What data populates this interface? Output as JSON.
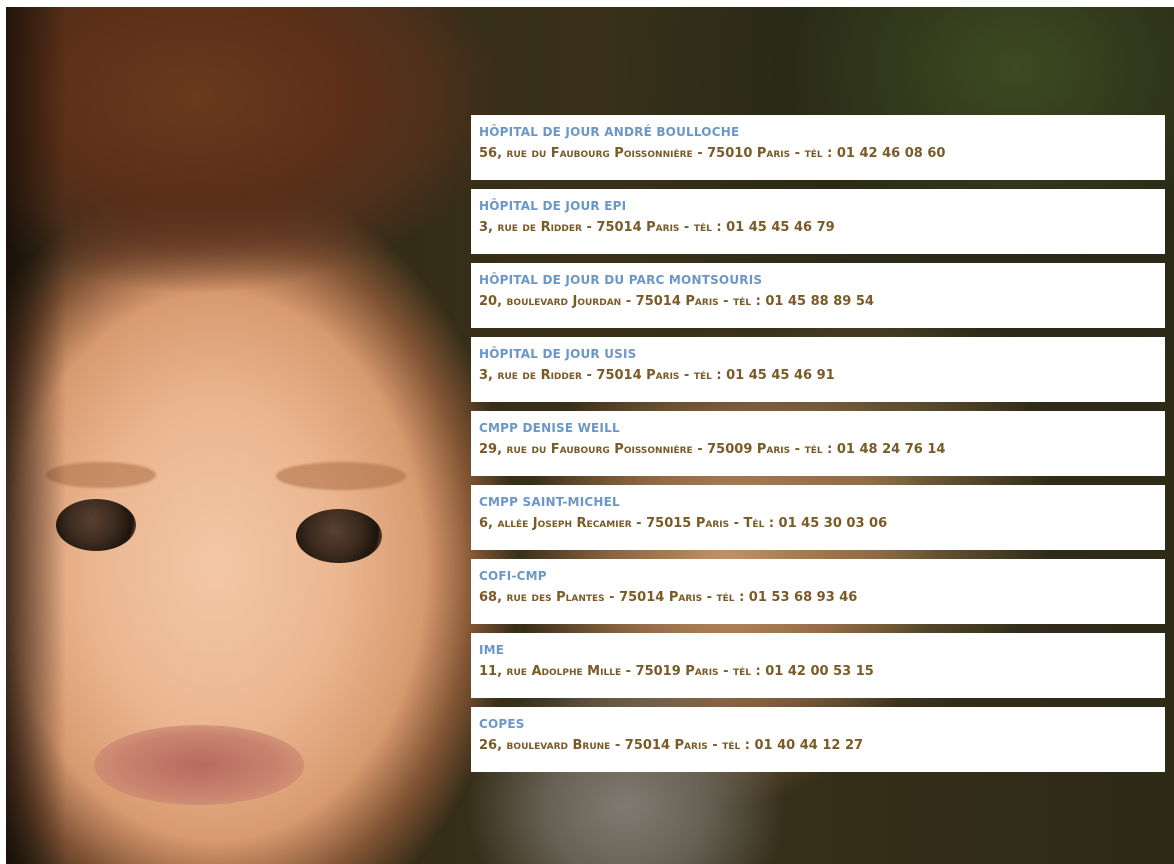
{
  "photo": {
    "description_icon": "child-portrait-photo"
  },
  "colors": {
    "title": "#6b97c8",
    "address": "#7a5a26",
    "card_background": "#ffffff"
  },
  "entries": [
    {
      "name": "Hôpital de jour André Boulloche",
      "address": "56, rue du Faubourg Poissonnière - 75010 Paris - tél : 01 42 46 08 60"
    },
    {
      "name": "Hôpital de jour EPI",
      "address": "3, rue de Ridder - 75014 Paris - tél : 01 45 45 46 79"
    },
    {
      "name": "Hôpital de jour du Parc Montsouris",
      "address": "20, boulevard Jourdan - 75014 Paris - tél : 01 45 88 89 54"
    },
    {
      "name": "Hôpital de jour USIS",
      "address": "3, rue de Ridder - 75014 Paris - tél : 01 45 45 46 91"
    },
    {
      "name": "CMPP Denise Weill",
      "address": "29, rue du Faubourg Poissonnière - 75009 Paris - tél : 01 48 24 76 14"
    },
    {
      "name": "CMPP Saint-Michel",
      "address": "6, allée Joseph Recamier - 75015 Paris - Tél : 01 45 30 03 06"
    },
    {
      "name": "COFI-CMP",
      "address": "68, rue des Plantes - 75014 Paris - tél : 01 53 68 93 46"
    },
    {
      "name": "IME",
      "address": "11, rue Adolphe Mille - 75019 Paris - tél : 01 42 00 53 15"
    },
    {
      "name": "COPES",
      "address": "26, boulevard Brune - 75014 Paris - tél : 01 40 44 12 27"
    }
  ]
}
